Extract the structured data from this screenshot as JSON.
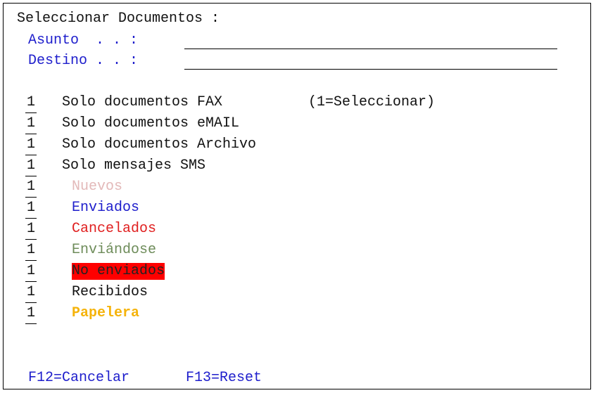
{
  "title": "Seleccionar Documentos :",
  "fields": {
    "asunto_label": "Asunto  . . :",
    "asunto_value": "",
    "destino_label": "Destino . . :",
    "destino_value": ""
  },
  "options_hint": "(1=Seleccionar)",
  "options": [
    {
      "value": "1",
      "label": "Solo documentos FAX"
    },
    {
      "value": "1",
      "label": "Solo documentos eMAIL"
    },
    {
      "value": "1",
      "label": "Solo documentos Archivo"
    },
    {
      "value": "1",
      "label": "Solo mensajes SMS"
    },
    {
      "value": "1",
      "label": "Nuevos"
    },
    {
      "value": "1",
      "label": "Enviados"
    },
    {
      "value": "1",
      "label": "Cancelados"
    },
    {
      "value": "1",
      "label": "Enviándose"
    },
    {
      "value": "1",
      "label": "No enviados"
    },
    {
      "value": "1",
      "label": "Recibidos"
    },
    {
      "value": "1",
      "label": "Papelera"
    }
  ],
  "colors": {
    "default": "#111111",
    "nuevos": "#e3b9b9",
    "enviados": "#1e1ecc",
    "cancelados": "#e02020",
    "enviandose": "#6e8c5a",
    "no_enviados_text": "#222222",
    "no_enviados_bg": "#ff0000",
    "recibidos": "#111111",
    "papelera": "#f5b30a"
  },
  "function_keys": {
    "f12": "F12=Cancelar",
    "f13": "F13=Reset"
  }
}
